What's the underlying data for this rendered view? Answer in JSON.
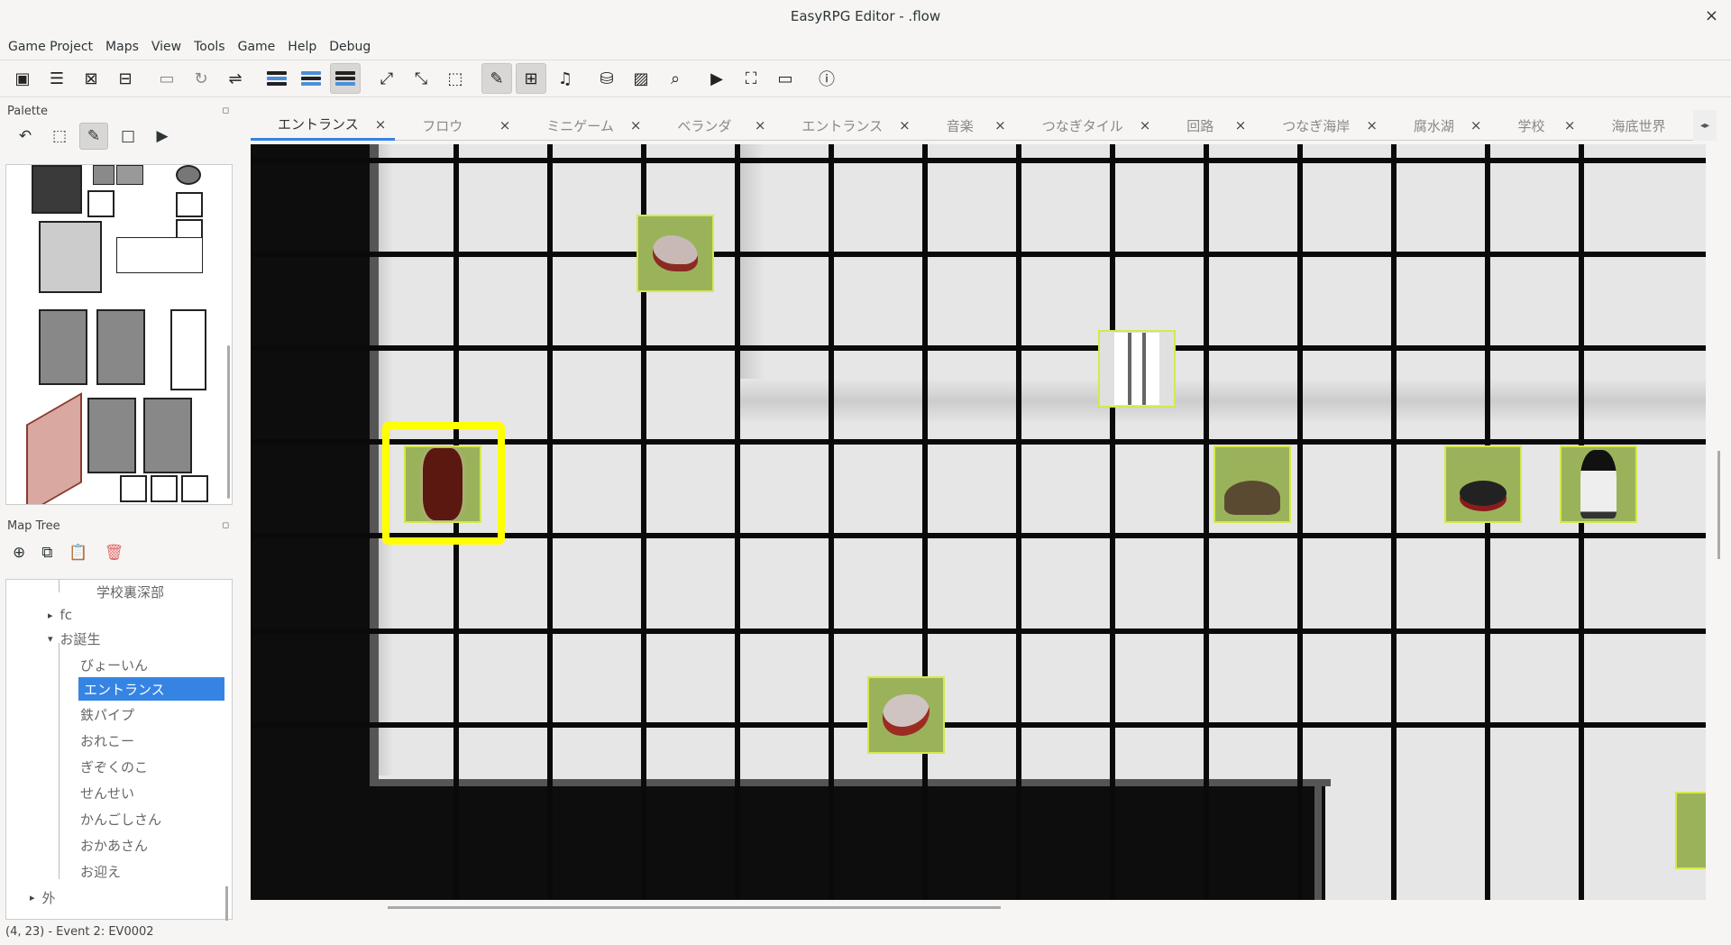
{
  "window": {
    "title": "EasyRPG Editor - .flow",
    "close": "×"
  },
  "menu": [
    "Game Project",
    "Maps",
    "View",
    "Tools",
    "Game",
    "Help",
    "Debug"
  ],
  "palette": {
    "title": "Palette"
  },
  "maptree": {
    "title": "Map Tree",
    "items": [
      {
        "label": "学校裏深部",
        "indent": 2,
        "arrow": ""
      },
      {
        "label": "fc",
        "indent": 1,
        "arrow": "▸"
      },
      {
        "label": "お誕生",
        "indent": 1,
        "arrow": "▾"
      },
      {
        "label": "びょーいん",
        "indent": 2,
        "arrow": ""
      },
      {
        "label": "エントランス",
        "indent": 2,
        "arrow": "",
        "selected": true
      },
      {
        "label": "鉄パイプ",
        "indent": 2,
        "arrow": ""
      },
      {
        "label": "おれこー",
        "indent": 2,
        "arrow": ""
      },
      {
        "label": "ぎぞくのこ",
        "indent": 2,
        "arrow": ""
      },
      {
        "label": "せんせい",
        "indent": 2,
        "arrow": ""
      },
      {
        "label": "かんごしさん",
        "indent": 2,
        "arrow": ""
      },
      {
        "label": "おかあさん",
        "indent": 2,
        "arrow": ""
      },
      {
        "label": "お迎え",
        "indent": 2,
        "arrow": ""
      },
      {
        "label": "外",
        "indent": 0,
        "arrow": "▸"
      }
    ]
  },
  "tabs": [
    {
      "label": "エントランス",
      "active": true
    },
    {
      "label": "フロウ"
    },
    {
      "label": "ミニゲーム"
    },
    {
      "label": "ベランダ"
    },
    {
      "label": "エントランス"
    },
    {
      "label": "音楽"
    },
    {
      "label": "つなぎタイル"
    },
    {
      "label": "回路"
    },
    {
      "label": "つなぎ海岸"
    },
    {
      "label": "腐水湖"
    },
    {
      "label": "学校"
    },
    {
      "label": "海底世界"
    }
  ],
  "tab_close": "×",
  "tab_nav": "◂▸",
  "status": "(4, 23) - Event 2: EV0002",
  "colors": {
    "accent": "#3584e4",
    "event_bg": "#9ab35a",
    "event_border": "#d6e84c",
    "selection": "#ffff00"
  }
}
